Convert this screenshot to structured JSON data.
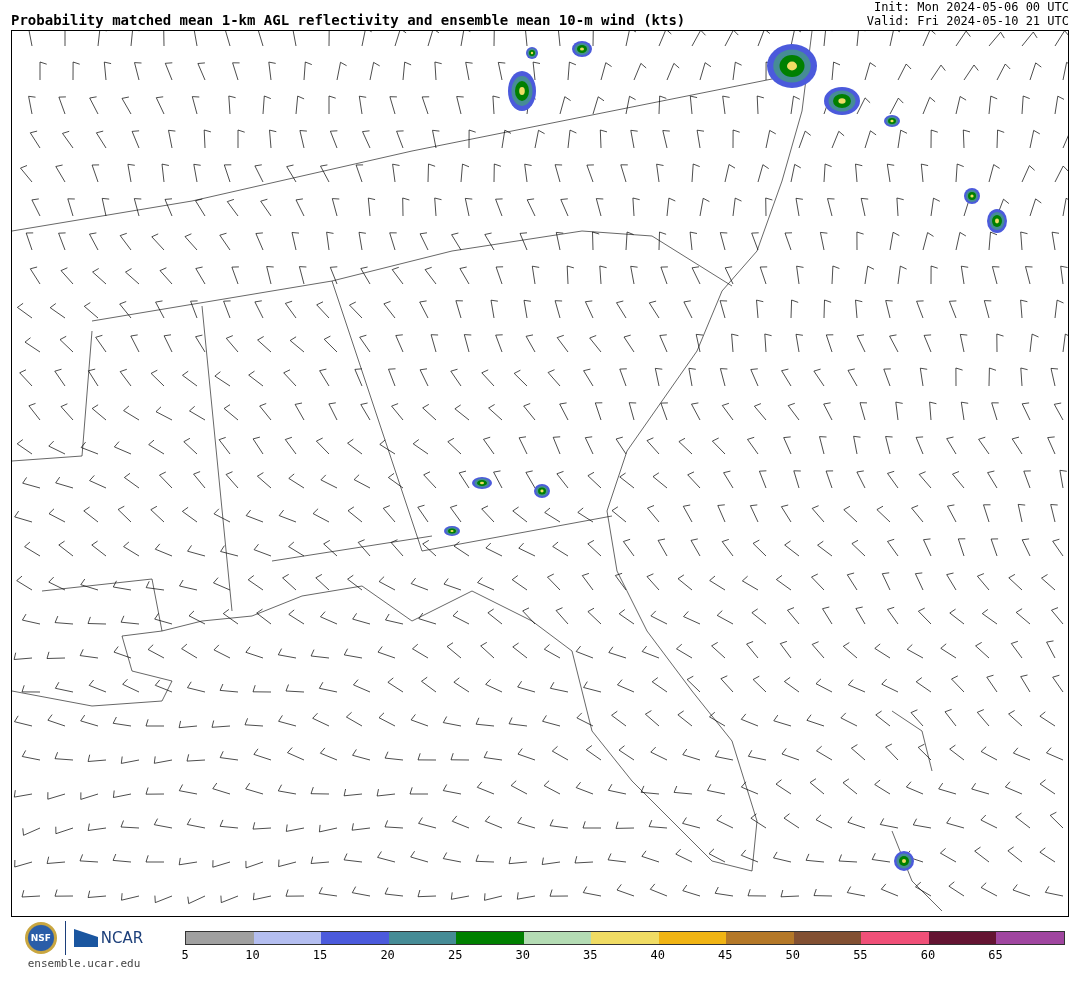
{
  "header": {
    "title": "Probability matched mean 1-km AGL reflectivity and ensemble mean 10-m wind (kts)",
    "init": "Init: Mon 2024-05-06 00 UTC",
    "valid": "Valid: Fri 2024-05-10 21 UTC"
  },
  "footer": {
    "nsf_logo": "NSF",
    "ncar_logo": "NCAR",
    "website": "ensemble.ucar.edu"
  },
  "colorbar": {
    "segments": [
      {
        "color": "#a0a0a0"
      },
      {
        "color": "#b4bef0"
      },
      {
        "color": "#4b5adc"
      },
      {
        "color": "#468c96"
      },
      {
        "color": "#008000"
      },
      {
        "color": "#b4dcb4"
      },
      {
        "color": "#f0dc64"
      },
      {
        "color": "#f0b414"
      },
      {
        "color": "#b47828"
      },
      {
        "color": "#825032"
      },
      {
        "color": "#f05078"
      },
      {
        "color": "#641432"
      },
      {
        "color": "#a046a0"
      }
    ],
    "ticks": [
      "5",
      "10",
      "15",
      "20",
      "25",
      "30",
      "35",
      "40",
      "45",
      "50",
      "55",
      "60",
      "65"
    ]
  }
}
